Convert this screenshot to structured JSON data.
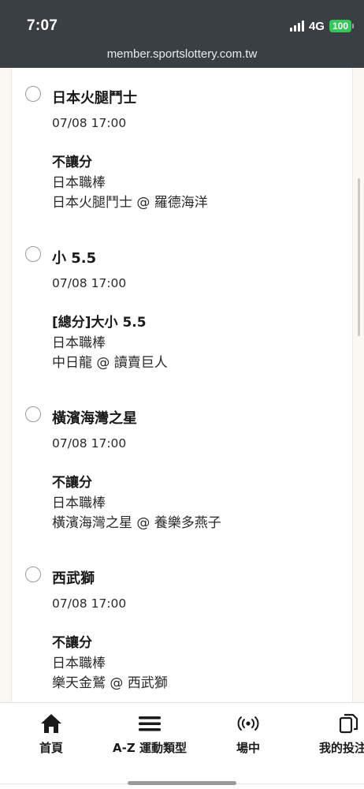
{
  "status_bar": {
    "time": "7:07",
    "network": "4G",
    "battery": "100"
  },
  "browser": {
    "url": "member.sportslottery.com.tw"
  },
  "bets": [
    {
      "selection": "日本火腿鬥士",
      "datetime": "07/08 17:00",
      "market": "不讓分",
      "league": "日本職棒",
      "match": "日本火腿鬥士 @ 羅德海洋"
    },
    {
      "selection": "小 5.5",
      "datetime": "07/08 17:00",
      "market": "[總分]大小 5.5",
      "league": "日本職棒",
      "match": "中日龍 @ 讀賣巨人"
    },
    {
      "selection": "橫濱海灣之星",
      "datetime": "07/08 17:00",
      "market": "不讓分",
      "league": "日本職棒",
      "match": "橫濱海灣之星 @ 養樂多燕子"
    },
    {
      "selection": "西武獅",
      "datetime": "07/08 17:00",
      "market": "不讓分",
      "league": "日本職棒",
      "match": "樂天金鷲 @ 西武獅"
    }
  ],
  "bottom_nav": {
    "home": "首頁",
    "az_sports": "A-Z 運動類型",
    "live": "場中",
    "my_bets": "我的投注"
  },
  "colors": {
    "status_bg": "#3a3f44",
    "battery_green": "#34c759",
    "page_bg": "#fbf8f4"
  }
}
